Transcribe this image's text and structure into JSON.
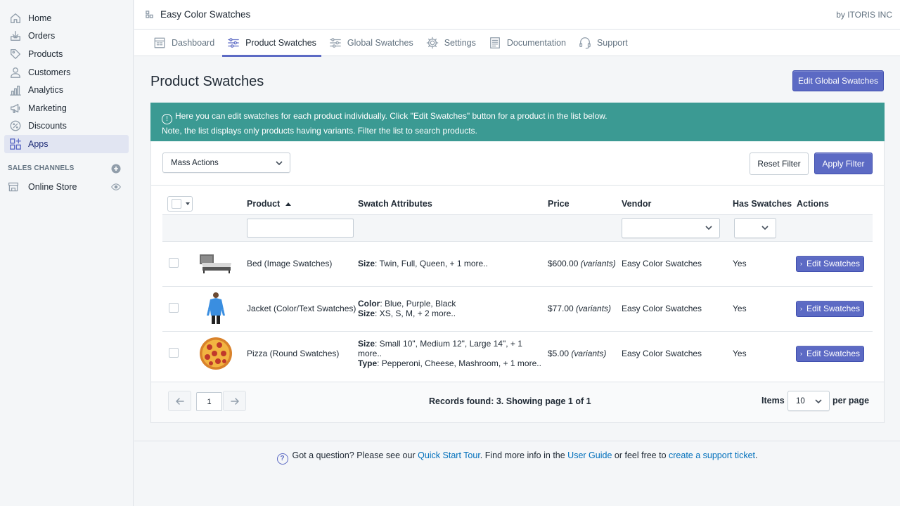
{
  "sidebar": {
    "items": [
      {
        "label": "Home",
        "icon": "home-icon"
      },
      {
        "label": "Orders",
        "icon": "orders-icon"
      },
      {
        "label": "Products",
        "icon": "tag-icon"
      },
      {
        "label": "Customers",
        "icon": "user-icon"
      },
      {
        "label": "Analytics",
        "icon": "bar-chart-icon"
      },
      {
        "label": "Marketing",
        "icon": "megaphone-icon"
      },
      {
        "label": "Discounts",
        "icon": "discount-icon"
      },
      {
        "label": "Apps",
        "icon": "apps-icon",
        "active": true
      }
    ],
    "sales_channels_label": "SALES CHANNELS",
    "online_store_label": "Online Store"
  },
  "topbar": {
    "app_title": "Easy Color Swatches",
    "by_text": "by ITORIS INC"
  },
  "tabs": [
    {
      "label": "Dashboard"
    },
    {
      "label": "Product Swatches",
      "active": true
    },
    {
      "label": "Global Swatches"
    },
    {
      "label": "Settings"
    },
    {
      "label": "Documentation"
    },
    {
      "label": "Support"
    }
  ],
  "page": {
    "title": "Product Swatches",
    "edit_global_label": "Edit Global Swatches",
    "notice_line1": "Here you can edit swatches for each product individually. Click \"Edit Swatches\" button for a product in the list below.",
    "notice_line2": "Note, the list displays only products having variants. Filter the list to search products."
  },
  "filters": {
    "mass_actions": "Mass Actions",
    "reset_label": "Reset Filter",
    "apply_label": "Apply Filter"
  },
  "table": {
    "headers": {
      "product": "Product",
      "attributes": "Swatch Attributes",
      "price": "Price",
      "vendor": "Vendor",
      "has_swatches": "Has Swatches",
      "actions": "Actions"
    },
    "edit_label": "Edit Swatches",
    "rows": [
      {
        "name": "Bed (Image Swatches)",
        "image": "bed-image",
        "attrs": [
          {
            "key": "Size",
            "value": ": Twin, Full, Queen, + 1 more.."
          }
        ],
        "price": "$600.00",
        "price_note": "(variants)",
        "vendor": "Easy Color Swatches",
        "has": "Yes"
      },
      {
        "name": "Jacket (Color/Text Swatches)",
        "image": "jacket-image",
        "attrs": [
          {
            "key": "Color",
            "value": ": Blue, Purple, Black"
          },
          {
            "key": "Size",
            "value": ": XS, S, M, + 2 more.."
          }
        ],
        "price": "$77.00",
        "price_note": "(variants)",
        "vendor": "Easy Color Swatches",
        "has": "Yes"
      },
      {
        "name": "Pizza (Round Swatches)",
        "image": "pizza-image",
        "attrs": [
          {
            "key": "Size",
            "value": ": Small 10\", Medium 12\", Large 14\", + 1 more.."
          },
          {
            "key": "Type",
            "value": ": Pepperoni, Cheese, Mashroom, + 1 more.."
          }
        ],
        "price": "$5.00",
        "price_note": "(variants)",
        "vendor": "Easy Color Swatches",
        "has": "Yes"
      }
    ]
  },
  "pager": {
    "page": "1",
    "records": "Records found: 3. Showing page 1 of 1",
    "items_label": "Items",
    "per_page_value": "10",
    "per_page_label": "per page"
  },
  "footer": {
    "t1": "Got a question? Please see our ",
    "link1": "Quick Start Tour",
    "t2": ". Find more info in the ",
    "link2": "User Guide",
    "t3": " or feel free to ",
    "link3": "create a support ticket",
    "t4": "."
  },
  "colors": {
    "accent": "#5c6ac4",
    "notice_bg": "#3b9a93",
    "link": "#006fbb"
  }
}
